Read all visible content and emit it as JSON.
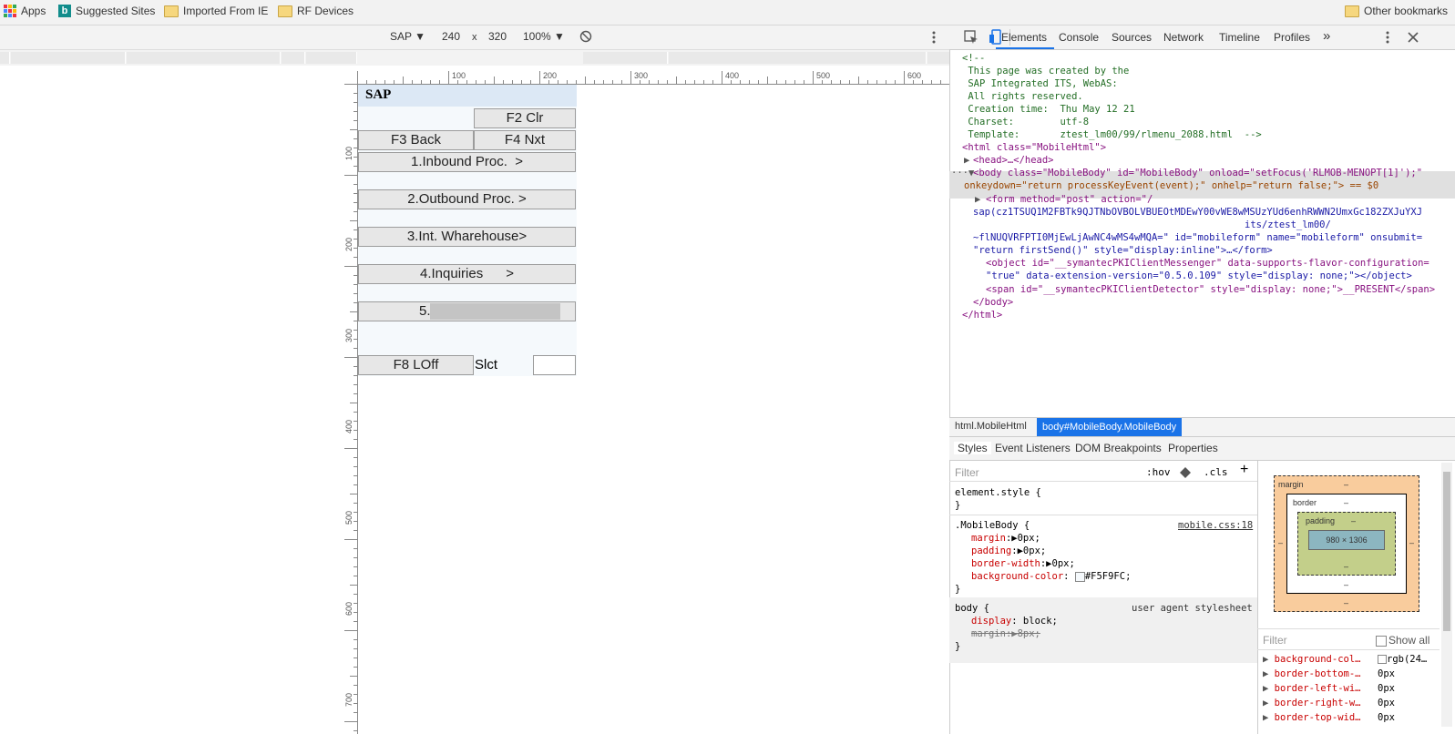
{
  "bookmarks": {
    "apps": "Apps",
    "suggested": "Suggested Sites",
    "imported": "Imported From IE",
    "rf": "RF Devices",
    "other": "Other bookmarks"
  },
  "device_toolbar": {
    "device": "SAP ▼",
    "width": "240",
    "times": "x",
    "height": "320",
    "zoom": "100% ▼"
  },
  "ruler": {
    "h": [
      "100",
      "200",
      "300",
      "400",
      "500",
      "600"
    ],
    "v": [
      "100",
      "200",
      "300",
      "400",
      "500",
      "600",
      "700"
    ]
  },
  "sap": {
    "title": "SAP",
    "f2": "F2 Clr",
    "f3": "F3 Back",
    "f4": "F4 Nxt",
    "menu": [
      "1.Inbound Proc.  >",
      "2.Outbound Proc. >",
      "3.Int. Wharehouse>",
      "4.Inquiries      >",
      "5."
    ],
    "f8": "F8 LOff",
    "slct": "Slct"
  },
  "devtools": {
    "tabs": [
      "Elements",
      "Console",
      "Sources",
      "Network",
      "Timeline",
      "Profiles"
    ],
    "more": "»",
    "comment": [
      "<!--",
      " This page was created by the",
      " SAP Integrated ITS, WebAS:",
      " All rights reserved.",
      " Creation time:  Thu May 12 21",
      " Charset:        utf-8",
      " Template:       ztest_lm00/99/rlmenu_2088.html  -->"
    ],
    "html_open": "<html class=\"MobileHtml\">",
    "head": "<head>…</head>",
    "body1": "<body class=\"MobileBody\" id=\"MobileBody\" onload=\"setFocus('RLMOB-MENOPT[1]');\"",
    "body2": "onkeydown=\"return processKeyEvent(event);\" onhelp=\"return false;\"> == $0",
    "form1": "<form method=\"post\" action=\"/",
    "form2": "sap(cz1TSUQ1M2FBTk9QJTNbOVBOLVBUEOtMDEwY00vWE8wMSUzYUd6enhRWWN2UmxGc182ZXJuYXJ",
    "form3": "its/ztest_lm00/",
    "form4": "~flNUQVRFPTI0MjEwLjAwNC4wMS4wMQA=\" id=\"mobileform\" name=\"mobileform\" onsubmit=",
    "form5": "\"return firstSend()\" style=\"display:inline\">…</form>",
    "obj1": "<object id=\"__symantecPKIClientMessenger\" data-supports-flavor-configuration=",
    "obj2": "\"true\" data-extension-version=\"0.5.0.109\" style=\"display: none;\"></object>",
    "span1": "<span id=\"__symantecPKIClientDetector\" style=\"display: none;\">__PRESENT</span>",
    "body_close": "</body>",
    "html_close": "</html>",
    "crumb1": "html.MobileHtml",
    "crumb2": "body#MobileBody.MobileBody",
    "style_tabs": [
      "Styles",
      "Event Listeners",
      "DOM Breakpoints",
      "Properties"
    ],
    "filter": "Filter",
    "hov": ":hov",
    "cls": ".cls",
    "plus": "+",
    "element_style": "element.style {",
    "close": "}",
    "mb_sel": ".MobileBody {",
    "mb_src": "mobile.css:18",
    "mb_props": [
      {
        "name": "margin",
        "val": "0px;"
      },
      {
        "name": "padding",
        "val": "0px;"
      },
      {
        "name": "border-width",
        "val": "0px;"
      },
      {
        "name": "background-color",
        "val": "#F5F9FC;"
      }
    ],
    "body_sel": "body {",
    "ua": "user agent stylesheet",
    "ua_props": [
      {
        "name": "display",
        "val": "block;"
      },
      {
        "name": "margin",
        "val": "8px;"
      }
    ],
    "box": {
      "margin": "margin",
      "border": "border",
      "padding": "padding",
      "dash": "–",
      "size": "980 × 1306"
    },
    "computed_filter": "Filter",
    "show_all": "Show all",
    "computed": [
      {
        "name": "background-col…",
        "val": "rgb(24…"
      },
      {
        "name": "border-bottom-…",
        "val": "0px"
      },
      {
        "name": "border-left-wi…",
        "val": "0px"
      },
      {
        "name": "border-right-w…",
        "val": "0px"
      },
      {
        "name": "border-top-wid…",
        "val": "0px"
      }
    ]
  }
}
